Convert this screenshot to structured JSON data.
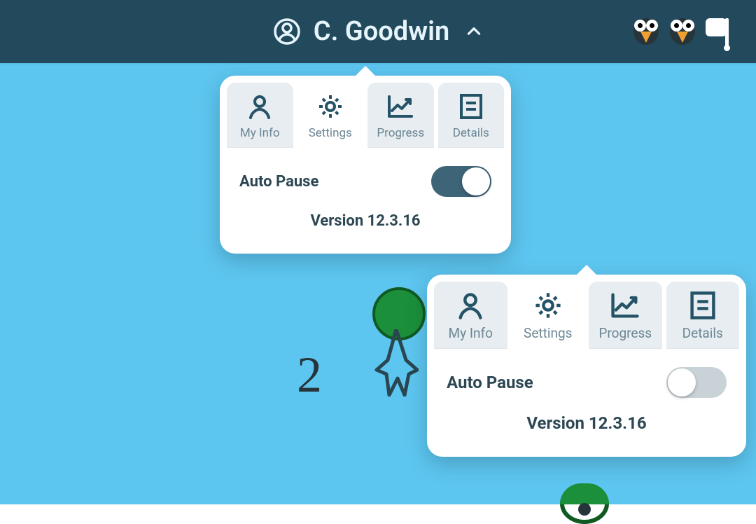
{
  "header": {
    "user_name": "C. Goodwin"
  },
  "panel_a": {
    "tabs": {
      "my_info": "My Info",
      "settings": "Settings",
      "progress": "Progress",
      "details": "Details"
    },
    "auto_pause_label": "Auto Pause",
    "auto_pause_on": true,
    "version_label": "Version 12.3.16"
  },
  "panel_b": {
    "tabs": {
      "my_info": "My Info",
      "settings": "Settings",
      "progress": "Progress",
      "details": "Details"
    },
    "auto_pause_label": "Auto Pause",
    "auto_pause_on": false,
    "version_label": "Version 12.3.16"
  },
  "background": {
    "number": "2"
  },
  "colors": {
    "header_bg": "#224a5c",
    "sky": "#5dc6f0",
    "icon_dark": "#245266",
    "toggle_on": "#3e6477",
    "toggle_off": "#c9d2d6"
  }
}
